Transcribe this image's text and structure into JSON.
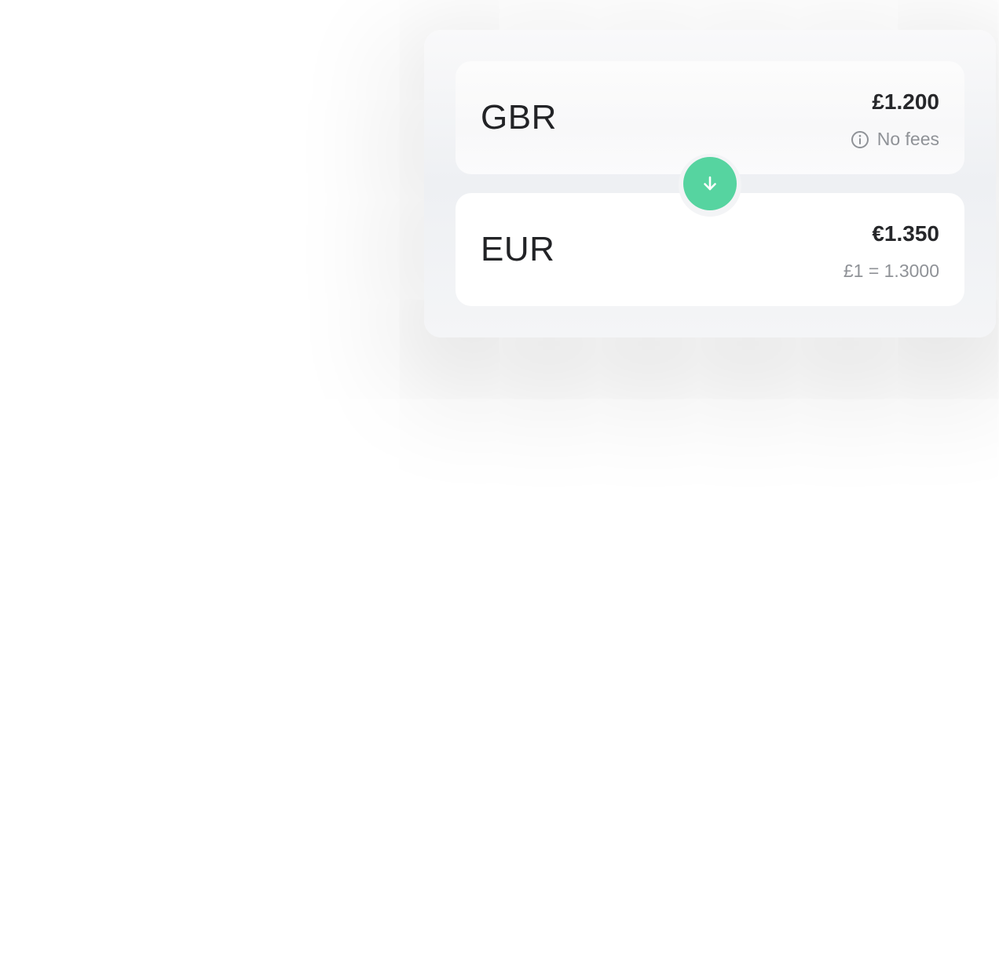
{
  "converter": {
    "from": {
      "currency": "GBR",
      "amount": "£1.200",
      "note": "No fees",
      "note_icon": "info-circle-icon"
    },
    "to": {
      "currency": "EUR",
      "amount": "€1.350",
      "rate": "£1 = 1.3000"
    },
    "swap": {
      "icon": "arrow-down-icon",
      "color": "#56d4a0"
    }
  }
}
